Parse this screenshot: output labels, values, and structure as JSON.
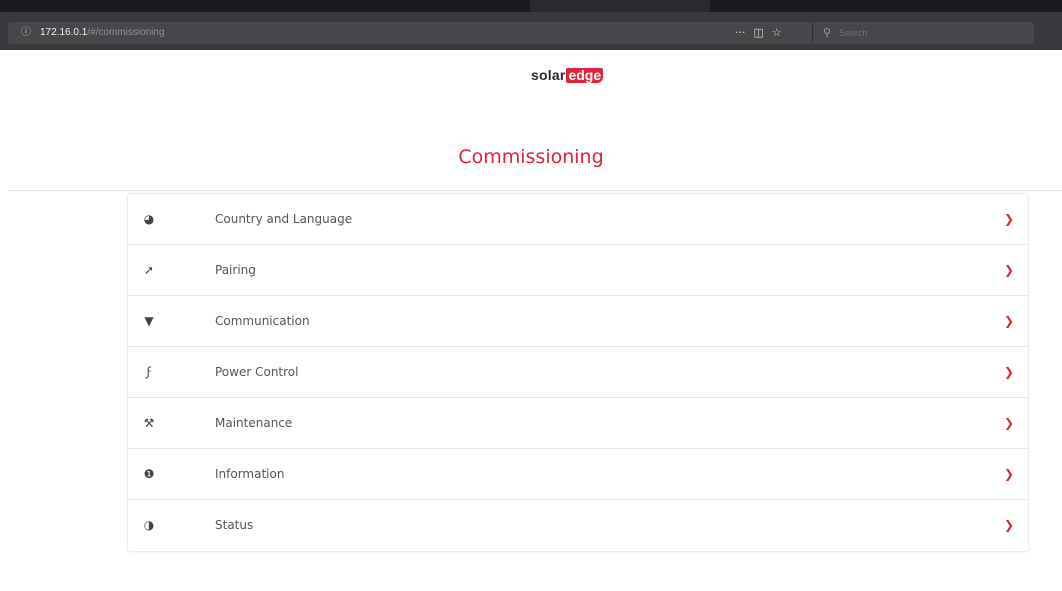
{
  "browser": {
    "url_host": "172.16.0.1",
    "url_path": "/#/commissioning",
    "toolbar_icons": [
      "more-actions-icon",
      "pocket-icon",
      "bookmark-star-icon"
    ],
    "search_placeholder": "Search"
  },
  "brand": {
    "logo_solar": "solar",
    "logo_edge": "edge",
    "accent_color": "#e2213a"
  },
  "page": {
    "title": "Commissioning"
  },
  "menu": {
    "items": [
      {
        "label": "Country and Language",
        "icon": "globe-icon"
      },
      {
        "label": "Pairing",
        "icon": "pairing-plug-icon"
      },
      {
        "label": "Communication",
        "icon": "wifi-icon"
      },
      {
        "label": "Power Control",
        "icon": "lightning-bolt-icon"
      },
      {
        "label": "Maintenance",
        "icon": "wrench-icon"
      },
      {
        "label": "Information",
        "icon": "info-icon"
      },
      {
        "label": "Status",
        "icon": "dashboard-gauge-icon"
      }
    ]
  }
}
